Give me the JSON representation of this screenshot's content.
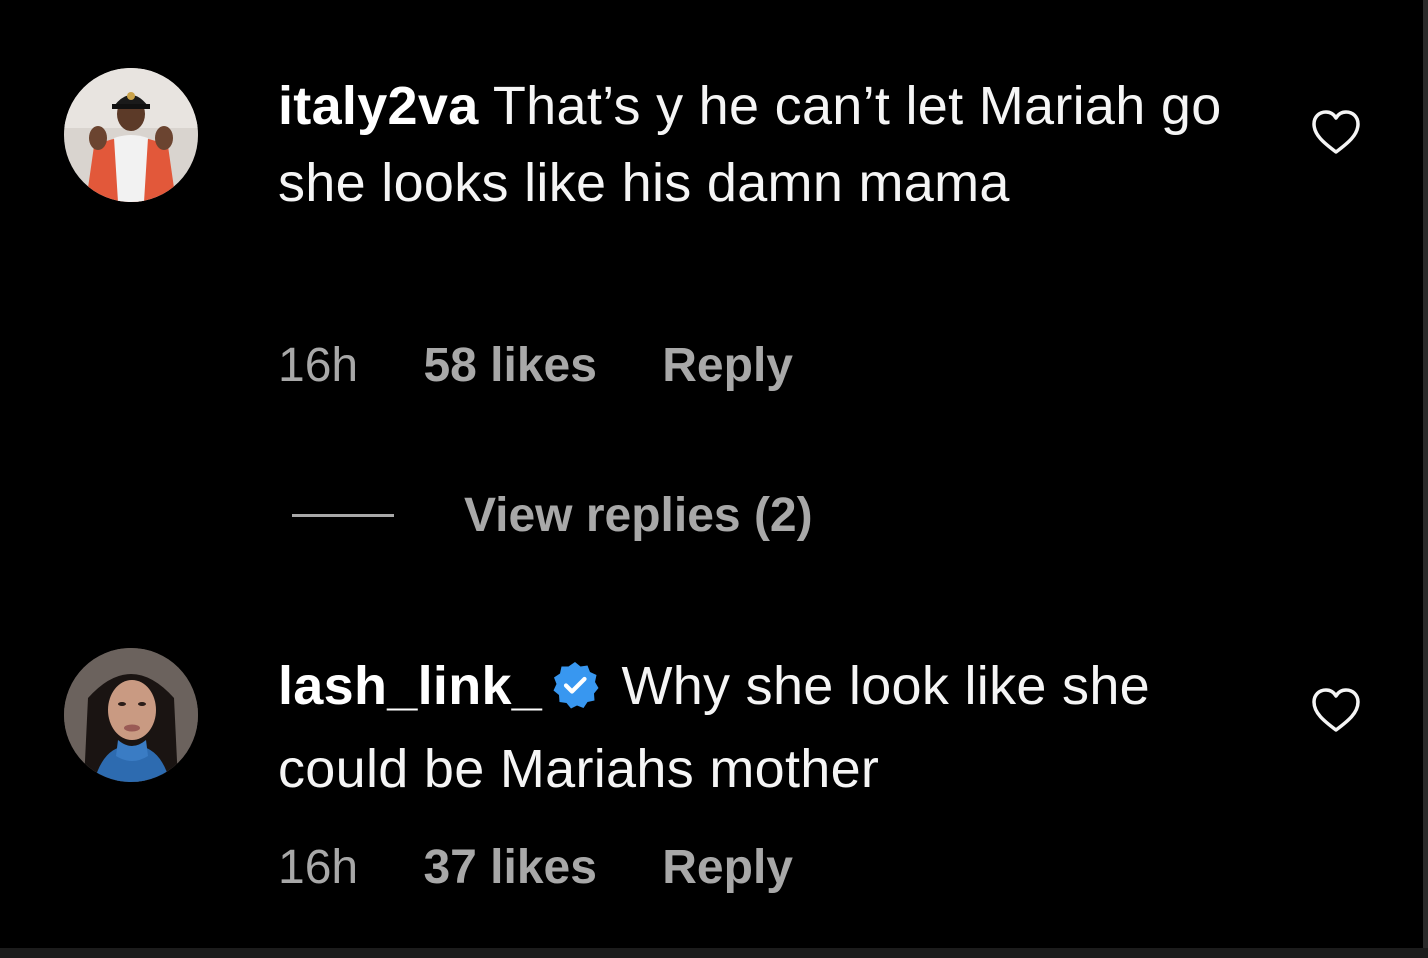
{
  "comments": [
    {
      "username": "italy2va",
      "verified": false,
      "text": "That’s y he can’t let Mariah go she looks like his damn mama",
      "time": "16h",
      "likes": "58 likes",
      "reply_label": "Reply",
      "liked": false
    },
    {
      "username": "lash_link_",
      "verified": true,
      "text": "Why she look like she could be Mariahs mother",
      "time": "16h",
      "likes": "37 likes",
      "reply_label": "Reply",
      "liked": false
    }
  ],
  "view_replies": {
    "label": "View replies (2)"
  },
  "colors": {
    "background": "#000000",
    "text": "#f5f5f5",
    "secondary": "#a8a8a8",
    "verified_badge": "#3897f0"
  }
}
